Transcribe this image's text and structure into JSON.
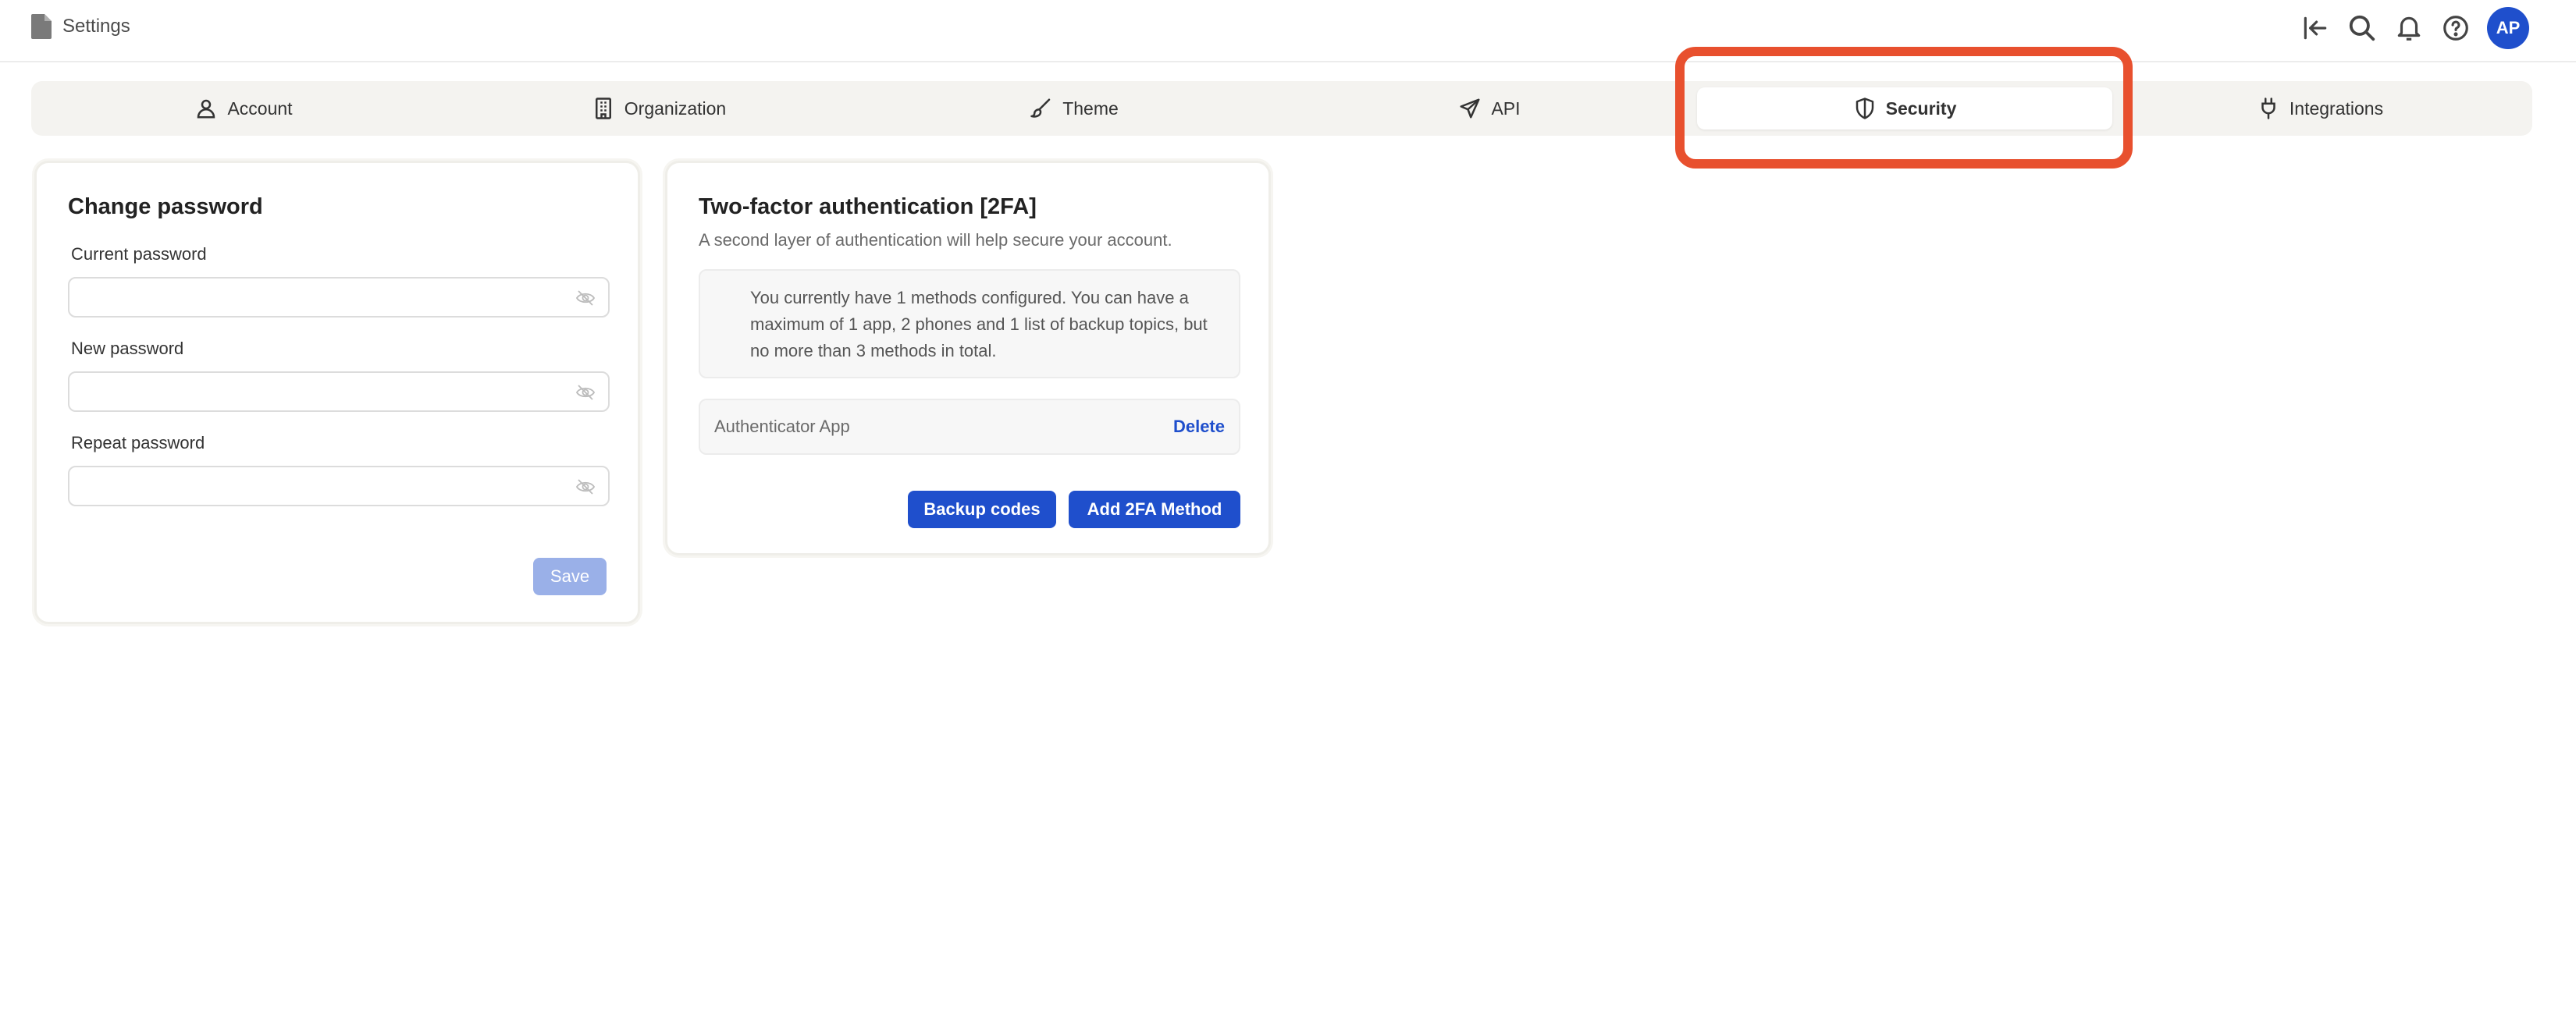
{
  "header": {
    "title": "Settings",
    "avatar_initials": "AP",
    "icons": [
      "back-arrow-icon",
      "search-icon",
      "bell-icon",
      "help-icon"
    ]
  },
  "tabs": [
    {
      "label": "Account",
      "icon": "user-icon",
      "active": false
    },
    {
      "label": "Organization",
      "icon": "building-icon",
      "active": false
    },
    {
      "label": "Theme",
      "icon": "brush-icon",
      "active": false
    },
    {
      "label": "API",
      "icon": "send-icon",
      "active": false
    },
    {
      "label": "Security",
      "icon": "shield-icon",
      "active": true
    },
    {
      "label": "Integrations",
      "icon": "plug-icon",
      "active": false
    }
  ],
  "password_card": {
    "title": "Change password",
    "current_label": "Current password",
    "current_value": "",
    "new_label": "New password",
    "new_value": "",
    "repeat_label": "Repeat password",
    "repeat_value": "",
    "save_label": "Save"
  },
  "tfa_card": {
    "title": "Two-factor authentication [2FA]",
    "subtitle": "A second layer of authentication will help secure your account.",
    "info_text": "You currently have 1 methods configured. You can have a maximum of 1 app, 2 phones and 1 list of backup topics, but no more than 3 methods in total.",
    "method_name": "Authenticator App",
    "delete_label": "Delete",
    "backup_label": "Backup codes",
    "add_label": "Add 2FA Method"
  },
  "colors": {
    "accent": "#1f4fcc",
    "highlight": "#e8502e",
    "save_disabled": "#9ab0e8",
    "tab_bg": "#f4f3f0"
  }
}
